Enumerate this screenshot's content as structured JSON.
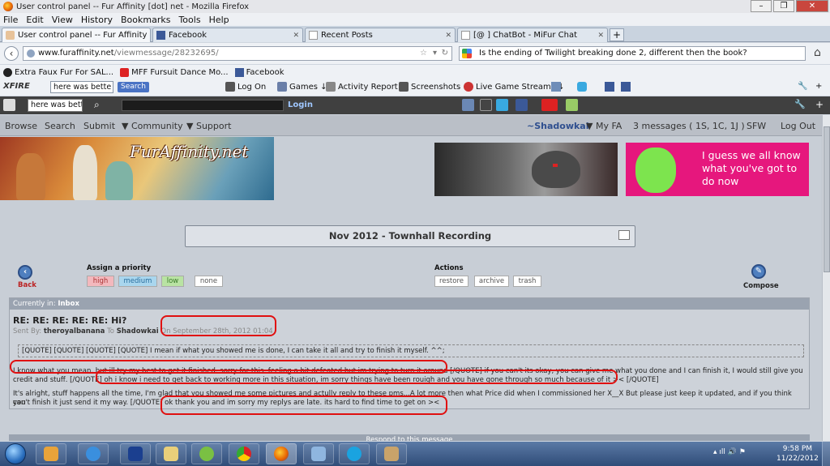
{
  "window": {
    "title": "User control panel -- Fur Affinity [dot] net - Mozilla Firefox",
    "buttons": [
      "–",
      "❐",
      "✕"
    ]
  },
  "menu": [
    "File",
    "Edit",
    "View",
    "History",
    "Bookmarks",
    "Tools",
    "Help"
  ],
  "tabs": [
    {
      "label": "User control panel -- Fur Affinity [dot]...",
      "active": true
    },
    {
      "label": "Facebook",
      "active": false
    },
    {
      "label": "Recent Posts",
      "active": false
    },
    {
      "label": "[@ ] ChatBot - MiFur Chat",
      "active": false
    }
  ],
  "newtab": "+",
  "nav": {
    "url_host": "www.furaffinity.net",
    "url_path": "/viewmessage/28232695/",
    "search_text": "Is the ending of Twilight breaking done 2, different then the book?"
  },
  "bookmarks": [
    {
      "label": "Extra Faux Fur For SAL..."
    },
    {
      "label": "MFF Fursuit Dance Mo..."
    },
    {
      "label": "Facebook"
    }
  ],
  "xfire": {
    "logo": "XFIRE",
    "search_value": "here was bette",
    "search_button": "Search",
    "items": [
      "Log On",
      "Games ↓",
      "Activity Report ↓",
      "Screenshots ↓",
      "Live Game Streams ↓"
    ]
  },
  "toolbar2": {
    "search_value": "here was bette",
    "login": "Login"
  },
  "fa_nav": {
    "left": [
      "Browse",
      "Search",
      "Submit",
      "▼ Community",
      "▼ Support"
    ],
    "user": "~Shadowkai",
    "myfa": "▼ My FA",
    "messages": "3 messages ( 1S, 1C, 1J )",
    "sfw": "SFW",
    "logout": "Log Out"
  },
  "banner": {
    "logo": "FurAffinity.net",
    "ad_text": "I guess we all know what you've got to do now"
  },
  "title_box": "Nov 2012 - Townhall Recording",
  "controls": {
    "back": "Back",
    "compose": "Compose",
    "assign_priority": "Assign a priority",
    "priorities": [
      "high",
      "medium",
      "low",
      "none"
    ],
    "actions_label": "Actions",
    "actions": [
      "restore",
      "archive",
      "trash"
    ]
  },
  "message": {
    "currently_in_label": "Currently in:",
    "currently_in": "Inbox",
    "subject": "RE: RE: RE: RE: RE: Hi?",
    "sent_by_label": "Sent By:",
    "sender": "theroyalbanana",
    "to_label": "To",
    "recipient": "Shadowkai",
    "on_label": "On",
    "date": "September 28th, 2012 01:04",
    "quote_line": "[QUOTE] [QUOTE] [QUOTE] [QUOTE] I mean if what you showed me is done, I can take it all and try to finish it myself. ^^;",
    "para1_line1": "I know what you mean, but ill try my best to get it finished, sorry for this, feeling a bit defeated but im trying to turn it around [/QUOTE] if you can't its okay, you can give me what you done and I can finish it, I would still give you",
    "para1_line2": "credit and stuff. [/QUOTE] oh i know i need to get back to working more in this situation, im sorry things have been rouigh and you have gone through so much because of it >< [/QUOTE]",
    "para2_line1": "It's alright, stuff happens all the time, I'm glad that you showed me some pictures and actully reply to these pms...A lot more then what Price did when I commissioned her X__X But please just keep it updated, and if you think you",
    "para2_line2": "can't finish it just send it my way. [/QUOTE] ok thank you and im sorry my replys are late. its hard to find time to get on ><"
  },
  "respond": "Respond to this message",
  "taskbar": {
    "time": "9:58 PM",
    "date": "11/22/2012"
  },
  "colors": {
    "annotation_red": "#e01010",
    "priority_high": "#f3b8bd",
    "priority_medium": "#a9d6ee",
    "priority_low": "#b9e3a3",
    "ad_pink": "#e6177d"
  }
}
